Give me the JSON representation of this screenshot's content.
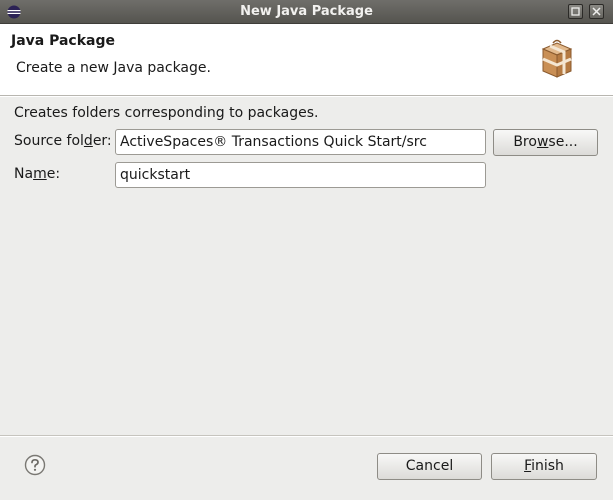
{
  "window": {
    "title": "New Java Package"
  },
  "header": {
    "title": "Java Package",
    "description": "Create a new Java package."
  },
  "form": {
    "info_text": "Creates folders corresponding to packages.",
    "source_folder": {
      "label_pre": "Source fol",
      "label_mnemonic": "d",
      "label_post": "er:",
      "value": "ActiveSpaces® Transactions Quick Start/src"
    },
    "browse_button": {
      "label_pre": "Bro",
      "label_mnemonic": "w",
      "label_post": "se..."
    },
    "name": {
      "label_pre": "Na",
      "label_mnemonic": "m",
      "label_post": "e:",
      "value": "quickstart"
    }
  },
  "footer": {
    "cancel_label": "Cancel",
    "finish_label_mnemonic": "F",
    "finish_label_post": "inish"
  },
  "icons": {
    "app": "eclipse-icon",
    "header": "package-icon",
    "help": "help-icon",
    "maximize": "maximize-icon",
    "close": "close-icon"
  }
}
